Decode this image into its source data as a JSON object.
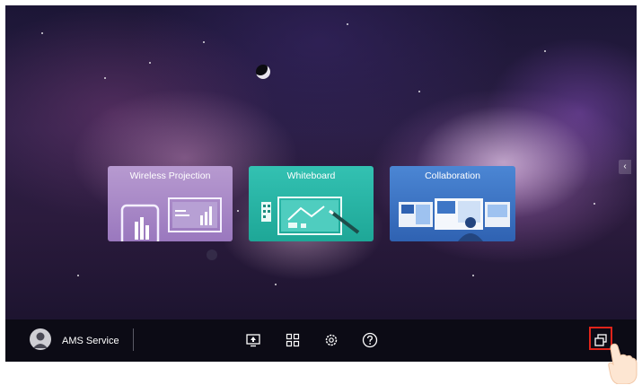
{
  "cards": {
    "wireless_projection": "Wireless Projection",
    "whiteboard": "Whiteboard",
    "collaboration": "Collaboration"
  },
  "taskbar": {
    "user_name": "AMS Service",
    "icons": [
      "screen-share-icon",
      "apps-grid-icon",
      "settings-gear-icon",
      "help-icon",
      "window-switch-icon"
    ]
  },
  "colors": {
    "wireless_projection_card": "#a487c6",
    "whiteboard_card": "#28b4a5",
    "collaboration_card": "#3e76c6",
    "taskbar": "#0c0b15",
    "highlight": "#e0241a"
  }
}
